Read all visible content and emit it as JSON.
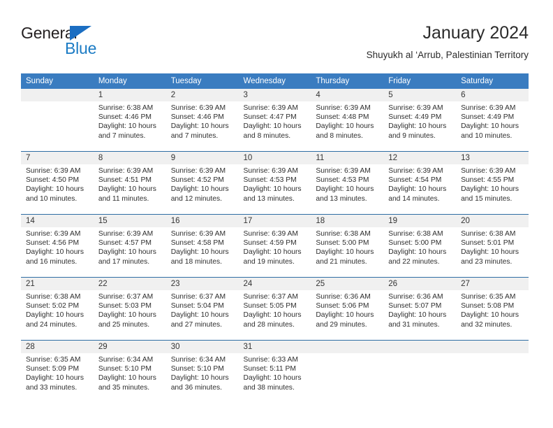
{
  "logo": {
    "word_one": "General",
    "word_two": "Blue",
    "triangle_icon": "triangle-icon",
    "accent_dark": "#231f20",
    "accent_blue": "#1b7bc4"
  },
  "header": {
    "title": "January 2024",
    "subtitle": "Shuyukh al ‘Arrub, Palestinian Territory"
  },
  "theme": {
    "header_bg": "#3a7cc0",
    "row_divider": "#2e6da4",
    "daynum_bg": "#f0f0f0",
    "text": "#2e2e2e"
  },
  "weekday_headers": [
    "Sunday",
    "Monday",
    "Tuesday",
    "Wednesday",
    "Thursday",
    "Friday",
    "Saturday"
  ],
  "labels": {
    "sunrise_prefix": "Sunrise:",
    "sunset_prefix": "Sunset:",
    "daylight_prefix": "Daylight:"
  },
  "weeks": [
    [
      {
        "day": "",
        "blank": true,
        "sunrise": "",
        "sunset": "",
        "daylight_line1": "",
        "daylight_line2": ""
      },
      {
        "day": "1",
        "blank": false,
        "sunrise": "Sunrise: 6:38 AM",
        "sunset": "Sunset: 4:46 PM",
        "daylight_line1": "Daylight: 10 hours",
        "daylight_line2": "and 7 minutes."
      },
      {
        "day": "2",
        "blank": false,
        "sunrise": "Sunrise: 6:39 AM",
        "sunset": "Sunset: 4:46 PM",
        "daylight_line1": "Daylight: 10 hours",
        "daylight_line2": "and 7 minutes."
      },
      {
        "day": "3",
        "blank": false,
        "sunrise": "Sunrise: 6:39 AM",
        "sunset": "Sunset: 4:47 PM",
        "daylight_line1": "Daylight: 10 hours",
        "daylight_line2": "and 8 minutes."
      },
      {
        "day": "4",
        "blank": false,
        "sunrise": "Sunrise: 6:39 AM",
        "sunset": "Sunset: 4:48 PM",
        "daylight_line1": "Daylight: 10 hours",
        "daylight_line2": "and 8 minutes."
      },
      {
        "day": "5",
        "blank": false,
        "sunrise": "Sunrise: 6:39 AM",
        "sunset": "Sunset: 4:49 PM",
        "daylight_line1": "Daylight: 10 hours",
        "daylight_line2": "and 9 minutes."
      },
      {
        "day": "6",
        "blank": false,
        "sunrise": "Sunrise: 6:39 AM",
        "sunset": "Sunset: 4:49 PM",
        "daylight_line1": "Daylight: 10 hours",
        "daylight_line2": "and 10 minutes."
      }
    ],
    [
      {
        "day": "7",
        "blank": false,
        "sunrise": "Sunrise: 6:39 AM",
        "sunset": "Sunset: 4:50 PM",
        "daylight_line1": "Daylight: 10 hours",
        "daylight_line2": "and 10 minutes."
      },
      {
        "day": "8",
        "blank": false,
        "sunrise": "Sunrise: 6:39 AM",
        "sunset": "Sunset: 4:51 PM",
        "daylight_line1": "Daylight: 10 hours",
        "daylight_line2": "and 11 minutes."
      },
      {
        "day": "9",
        "blank": false,
        "sunrise": "Sunrise: 6:39 AM",
        "sunset": "Sunset: 4:52 PM",
        "daylight_line1": "Daylight: 10 hours",
        "daylight_line2": "and 12 minutes."
      },
      {
        "day": "10",
        "blank": false,
        "sunrise": "Sunrise: 6:39 AM",
        "sunset": "Sunset: 4:53 PM",
        "daylight_line1": "Daylight: 10 hours",
        "daylight_line2": "and 13 minutes."
      },
      {
        "day": "11",
        "blank": false,
        "sunrise": "Sunrise: 6:39 AM",
        "sunset": "Sunset: 4:53 PM",
        "daylight_line1": "Daylight: 10 hours",
        "daylight_line2": "and 13 minutes."
      },
      {
        "day": "12",
        "blank": false,
        "sunrise": "Sunrise: 6:39 AM",
        "sunset": "Sunset: 4:54 PM",
        "daylight_line1": "Daylight: 10 hours",
        "daylight_line2": "and 14 minutes."
      },
      {
        "day": "13",
        "blank": false,
        "sunrise": "Sunrise: 6:39 AM",
        "sunset": "Sunset: 4:55 PM",
        "daylight_line1": "Daylight: 10 hours",
        "daylight_line2": "and 15 minutes."
      }
    ],
    [
      {
        "day": "14",
        "blank": false,
        "sunrise": "Sunrise: 6:39 AM",
        "sunset": "Sunset: 4:56 PM",
        "daylight_line1": "Daylight: 10 hours",
        "daylight_line2": "and 16 minutes."
      },
      {
        "day": "15",
        "blank": false,
        "sunrise": "Sunrise: 6:39 AM",
        "sunset": "Sunset: 4:57 PM",
        "daylight_line1": "Daylight: 10 hours",
        "daylight_line2": "and 17 minutes."
      },
      {
        "day": "16",
        "blank": false,
        "sunrise": "Sunrise: 6:39 AM",
        "sunset": "Sunset: 4:58 PM",
        "daylight_line1": "Daylight: 10 hours",
        "daylight_line2": "and 18 minutes."
      },
      {
        "day": "17",
        "blank": false,
        "sunrise": "Sunrise: 6:39 AM",
        "sunset": "Sunset: 4:59 PM",
        "daylight_line1": "Daylight: 10 hours",
        "daylight_line2": "and 19 minutes."
      },
      {
        "day": "18",
        "blank": false,
        "sunrise": "Sunrise: 6:38 AM",
        "sunset": "Sunset: 5:00 PM",
        "daylight_line1": "Daylight: 10 hours",
        "daylight_line2": "and 21 minutes."
      },
      {
        "day": "19",
        "blank": false,
        "sunrise": "Sunrise: 6:38 AM",
        "sunset": "Sunset: 5:00 PM",
        "daylight_line1": "Daylight: 10 hours",
        "daylight_line2": "and 22 minutes."
      },
      {
        "day": "20",
        "blank": false,
        "sunrise": "Sunrise: 6:38 AM",
        "sunset": "Sunset: 5:01 PM",
        "daylight_line1": "Daylight: 10 hours",
        "daylight_line2": "and 23 minutes."
      }
    ],
    [
      {
        "day": "21",
        "blank": false,
        "sunrise": "Sunrise: 6:38 AM",
        "sunset": "Sunset: 5:02 PM",
        "daylight_line1": "Daylight: 10 hours",
        "daylight_line2": "and 24 minutes."
      },
      {
        "day": "22",
        "blank": false,
        "sunrise": "Sunrise: 6:37 AM",
        "sunset": "Sunset: 5:03 PM",
        "daylight_line1": "Daylight: 10 hours",
        "daylight_line2": "and 25 minutes."
      },
      {
        "day": "23",
        "blank": false,
        "sunrise": "Sunrise: 6:37 AM",
        "sunset": "Sunset: 5:04 PM",
        "daylight_line1": "Daylight: 10 hours",
        "daylight_line2": "and 27 minutes."
      },
      {
        "day": "24",
        "blank": false,
        "sunrise": "Sunrise: 6:37 AM",
        "sunset": "Sunset: 5:05 PM",
        "daylight_line1": "Daylight: 10 hours",
        "daylight_line2": "and 28 minutes."
      },
      {
        "day": "25",
        "blank": false,
        "sunrise": "Sunrise: 6:36 AM",
        "sunset": "Sunset: 5:06 PM",
        "daylight_line1": "Daylight: 10 hours",
        "daylight_line2": "and 29 minutes."
      },
      {
        "day": "26",
        "blank": false,
        "sunrise": "Sunrise: 6:36 AM",
        "sunset": "Sunset: 5:07 PM",
        "daylight_line1": "Daylight: 10 hours",
        "daylight_line2": "and 31 minutes."
      },
      {
        "day": "27",
        "blank": false,
        "sunrise": "Sunrise: 6:35 AM",
        "sunset": "Sunset: 5:08 PM",
        "daylight_line1": "Daylight: 10 hours",
        "daylight_line2": "and 32 minutes."
      }
    ],
    [
      {
        "day": "28",
        "blank": false,
        "sunrise": "Sunrise: 6:35 AM",
        "sunset": "Sunset: 5:09 PM",
        "daylight_line1": "Daylight: 10 hours",
        "daylight_line2": "and 33 minutes."
      },
      {
        "day": "29",
        "blank": false,
        "sunrise": "Sunrise: 6:34 AM",
        "sunset": "Sunset: 5:10 PM",
        "daylight_line1": "Daylight: 10 hours",
        "daylight_line2": "and 35 minutes."
      },
      {
        "day": "30",
        "blank": false,
        "sunrise": "Sunrise: 6:34 AM",
        "sunset": "Sunset: 5:10 PM",
        "daylight_line1": "Daylight: 10 hours",
        "daylight_line2": "and 36 minutes."
      },
      {
        "day": "31",
        "blank": false,
        "sunrise": "Sunrise: 6:33 AM",
        "sunset": "Sunset: 5:11 PM",
        "daylight_line1": "Daylight: 10 hours",
        "daylight_line2": "and 38 minutes."
      },
      {
        "day": "",
        "blank": true,
        "sunrise": "",
        "sunset": "",
        "daylight_line1": "",
        "daylight_line2": ""
      },
      {
        "day": "",
        "blank": true,
        "sunrise": "",
        "sunset": "",
        "daylight_line1": "",
        "daylight_line2": ""
      },
      {
        "day": "",
        "blank": true,
        "sunrise": "",
        "sunset": "",
        "daylight_line1": "",
        "daylight_line2": ""
      }
    ]
  ]
}
